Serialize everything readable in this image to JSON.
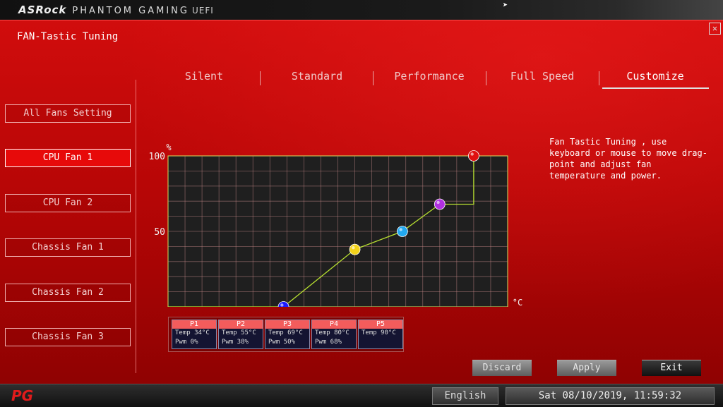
{
  "header": {
    "brand_main": "ASRock",
    "brand_sub": "PHANTOM GAMING",
    "brand_suffix": "UEFI",
    "cursor_icon": "mouse-cursor-icon"
  },
  "page": {
    "title": "FAN-Tastic Tuning",
    "close_icon": "close-icon"
  },
  "tabs": [
    {
      "label": "Silent",
      "active": false
    },
    {
      "label": "Standard",
      "active": false
    },
    {
      "label": "Performance",
      "active": false
    },
    {
      "label": "Full Speed",
      "active": false
    },
    {
      "label": "Customize",
      "active": true
    }
  ],
  "sidebar": {
    "items": [
      {
        "label": "All Fans Setting",
        "active": false
      },
      {
        "label": "CPU Fan 1",
        "active": true
      },
      {
        "label": "CPU Fan 2",
        "active": false
      },
      {
        "label": "Chassis Fan 1",
        "active": false
      },
      {
        "label": "Chassis Fan 2",
        "active": false
      },
      {
        "label": "Chassis Fan 3",
        "active": false
      }
    ]
  },
  "description": "Fan Tastic Tuning , use keyboard or mouse to move drag-point and adjust fan temperature and power.",
  "points": [
    {
      "name": "P1",
      "temp": "Temp 34°C",
      "pwm": "Pwm  0%",
      "color": "#1a1aff"
    },
    {
      "name": "P2",
      "temp": "Temp 55°C",
      "pwm": "Pwm  38%",
      "color": "#f2d21a"
    },
    {
      "name": "P3",
      "temp": "Temp 69°C",
      "pwm": "Pwm  50%",
      "color": "#22a8f0"
    },
    {
      "name": "P4",
      "temp": "Temp 80°C",
      "pwm": "Pwm  68%",
      "color": "#b030e0"
    },
    {
      "name": "P5",
      "temp": "Temp 90°C",
      "pwm": "",
      "color": "#e01010"
    }
  ],
  "chart_data": {
    "type": "line",
    "ylabel": "%",
    "xlabel": "°C",
    "xlim": [
      0,
      100
    ],
    "ylim": [
      0,
      100
    ],
    "x_ticks": [
      "0",
      "25",
      "50",
      "75",
      "100"
    ],
    "y_ticks": [
      "100",
      "50"
    ],
    "grid": true,
    "series": [
      {
        "x": [
          0,
          34,
          55,
          69,
          80,
          90,
          90
        ],
        "y": [
          0,
          0,
          38,
          50,
          68,
          68,
          100
        ]
      }
    ],
    "drag_points": [
      {
        "x": 34,
        "y": 0
      },
      {
        "x": 55,
        "y": 38
      },
      {
        "x": 69,
        "y": 50
      },
      {
        "x": 80,
        "y": 68
      },
      {
        "x": 90,
        "y": 100
      }
    ]
  },
  "actions": {
    "discard": "Discard",
    "apply": "Apply",
    "exit": "Exit"
  },
  "footer": {
    "logo": "PG",
    "language": "English",
    "datetime": "Sat 08/10/2019, 11:59:32"
  }
}
